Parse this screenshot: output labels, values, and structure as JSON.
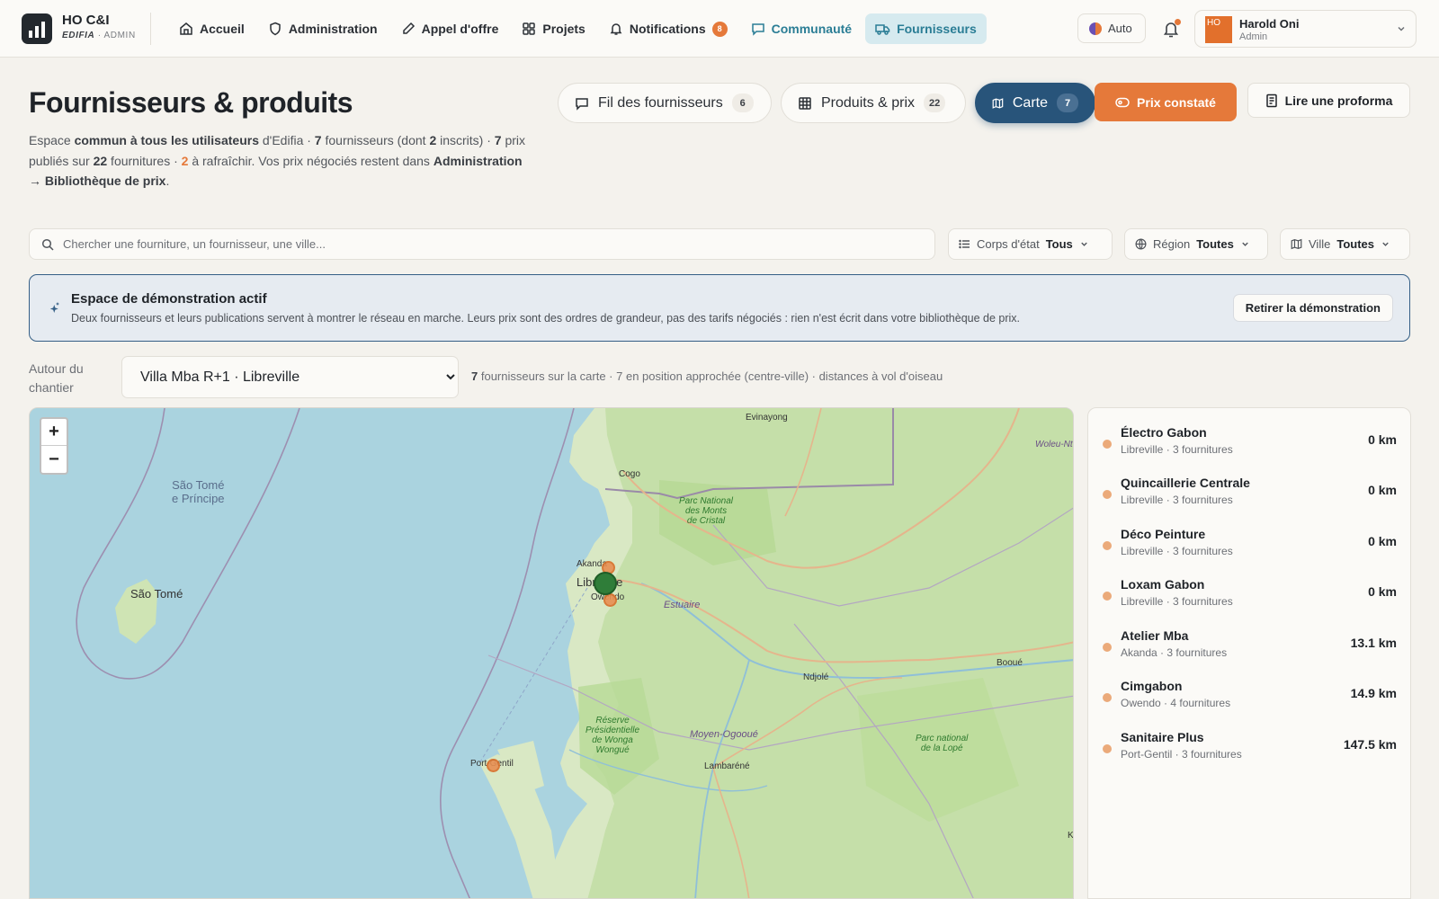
{
  "app": {
    "name": "HO C&I",
    "org": "EDIFIA",
    "role_tag": "· ADMIN"
  },
  "nav": {
    "items": [
      {
        "label": "Accueil",
        "icon": "home-icon"
      },
      {
        "label": "Administration",
        "icon": "shield-icon"
      },
      {
        "label": "Appel d'offre",
        "icon": "pen-icon"
      },
      {
        "label": "Projets",
        "icon": "grid-icon"
      },
      {
        "label": "Notifications",
        "icon": "bell-icon",
        "badge": "8"
      },
      {
        "label": "Communauté",
        "icon": "chat-icon"
      },
      {
        "label": "Fournisseurs",
        "icon": "truck-icon",
        "active": true
      }
    ]
  },
  "theme": {
    "label": "Auto"
  },
  "user": {
    "initials": "HO",
    "name": "Harold Oni",
    "role": "Admin"
  },
  "header": {
    "title": "Fournisseurs & produits",
    "desc": {
      "p1": "Espace ",
      "b1": "commun à tous les utilisateurs",
      "p2": " d'Edifia · ",
      "n1": "7",
      "p3": " fournisseurs (dont ",
      "n2": "2",
      "p4": " inscrits) · ",
      "n3": "7",
      "p5": " prix publiés sur ",
      "n4": "22",
      "p6": " fournitures · ",
      "n5": "2",
      "p7": " à rafraîchir. Vos prix négociés restent dans ",
      "b2": "Administration → Bibliothèque de prix",
      "p8": "."
    }
  },
  "views": [
    {
      "label": "Fil des fournisseurs",
      "count": "6"
    },
    {
      "label": "Produits & prix",
      "count": "22"
    },
    {
      "label": "Carte",
      "count": "7",
      "active": true
    }
  ],
  "actions": {
    "price_seen": "Prix constaté",
    "read_proforma": "Lire une proforma"
  },
  "filters": {
    "search_placeholder": "Chercher une fourniture, un fournisseur, une ville...",
    "trade": {
      "label": "Corps d'état",
      "value": "Tous"
    },
    "region": {
      "label": "Région",
      "value": "Toutes"
    },
    "city": {
      "label": "Ville",
      "value": "Toutes"
    }
  },
  "demo": {
    "title": "Espace de démonstration actif",
    "text": "Deux fournisseurs et leurs publications servent à montrer le réseau en marche. Leurs prix sont des ordres de grandeur, pas des tarifs négociés : rien n'est écrit dans votre bibliothèque de prix.",
    "button": "Retirer la démonstration"
  },
  "around": {
    "label": "Autour du chantier",
    "selected": "Villa Mba R+1 · Libreville",
    "info_count": "7",
    "info_text": " fournisseurs sur la carte · 7 en position approchée (centre-ville) · distances à vol d'oiseau"
  },
  "map": {
    "zoom_in": "+",
    "zoom_out": "−",
    "labels": {
      "stp": "São Tomé\ne Príncipe",
      "saotome": "São Tomé",
      "evinayong": "Evinayong",
      "cogo": "Cogo",
      "monts_cristal": "Parc National\ndes Monts\nde Cristal",
      "akanda": "Akanda",
      "libreville": "Libreville",
      "owendo": "Owendo",
      "estuaire": "Estuaire",
      "ndjole": "Ndjolé",
      "booue": "Booué",
      "woleu": "Woleu-Nt",
      "wonga": "Réserve\nPrésidentielle\nde Wonga\nWongué",
      "moyen_ogooue": "Moyen-Ogooué",
      "port_gentil": "Port-Gentil",
      "lambarene": "Lambaréné",
      "lope": "Parc national\nde la Lopé",
      "k": "K"
    }
  },
  "suppliers": [
    {
      "name": "Électro Gabon",
      "sub": "Libreville · 3 fournitures",
      "dist": "0 km"
    },
    {
      "name": "Quincaillerie Centrale",
      "sub": "Libreville · 3 fournitures",
      "dist": "0 km"
    },
    {
      "name": "Déco Peinture",
      "sub": "Libreville · 3 fournitures",
      "dist": "0 km"
    },
    {
      "name": "Loxam Gabon",
      "sub": "Libreville · 3 fournitures",
      "dist": "0 km"
    },
    {
      "name": "Atelier Mba",
      "sub": "Akanda · 3 fournitures",
      "dist": "13.1 km"
    },
    {
      "name": "Cimgabon",
      "sub": "Owendo · 4 fournitures",
      "dist": "14.9 km"
    },
    {
      "name": "Sanitaire Plus",
      "sub": "Port-Gentil · 3 fournitures",
      "dist": "147.5 km"
    }
  ],
  "colors": {
    "accent": "#e5793a",
    "teal": "#2a7d95",
    "navy": "#28547a",
    "site_marker": "#2f7d39"
  }
}
